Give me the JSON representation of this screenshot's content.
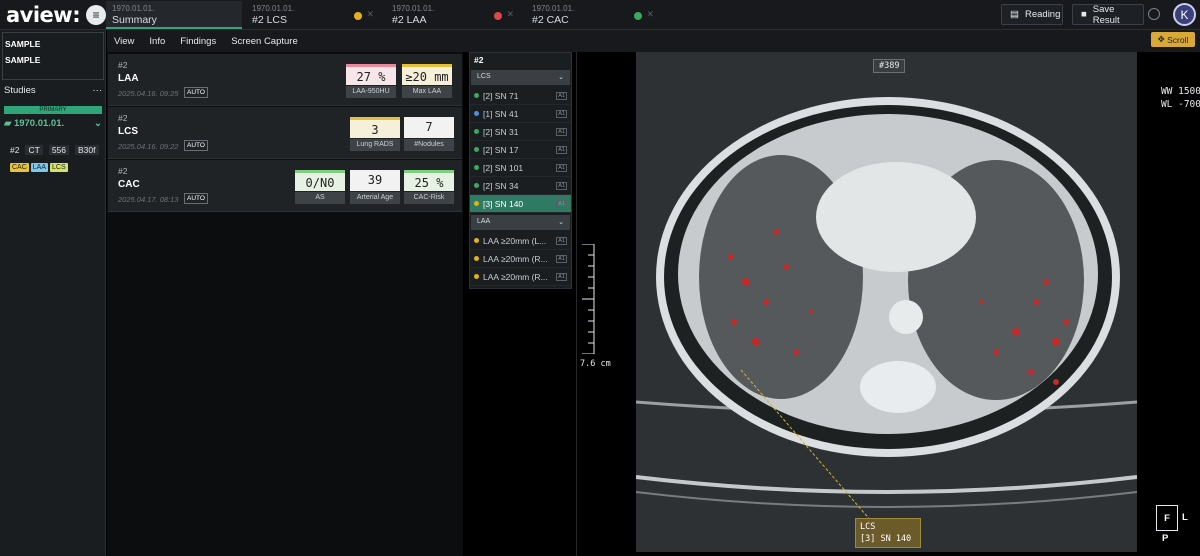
{
  "app": {
    "logo": "aview:",
    "logo_icon": "list-add-icon"
  },
  "tabs": [
    {
      "date": "1970.01.01.",
      "name": "Summary"
    },
    {
      "date": "1970.01.01.",
      "name": "#2  LCS",
      "status_color": "#e6b118"
    },
    {
      "date": "1970.01.01.",
      "name": "#2  LAA",
      "status_color": "#d84a4a"
    },
    {
      "date": "1970.01.01.",
      "name": "#2  CAC",
      "status_color": "#3caa5c"
    }
  ],
  "toolbar": {
    "reading_label": "Reading",
    "save_label": "Save Result",
    "avatar_initial": "K"
  },
  "sidebar": {
    "patient_name": "SAMPLE",
    "patient_id": "SAMPLE",
    "studies_label": "Studies",
    "more": "···",
    "primary_label": "PRIMARY",
    "study_date": "1970.01.01.",
    "series": {
      "number": "#2",
      "modality": "CT",
      "count": "556",
      "kernel": "B30f"
    },
    "badges": [
      {
        "label": "CAC",
        "color": "#e8c33a"
      },
      {
        "label": "LAA",
        "color": "#7cc7ee"
      },
      {
        "label": "LCS",
        "color": "#d6e36a"
      }
    ]
  },
  "menu": {
    "items": [
      "View",
      "Info",
      "Findings",
      "Screen Capture"
    ],
    "scroll_label": "Scroll"
  },
  "summary": {
    "cards": [
      {
        "idx": "#2",
        "title": "LAA",
        "time": "2025.04.16. 09:25",
        "auto": "AUTO",
        "metrics": [
          {
            "value": "27 %",
            "label": "LAA-950HU",
            "accent": "#e88a9a"
          },
          {
            "value": "≥20 mm",
            "label": "Max LAA",
            "accent": "#e6c03a"
          }
        ]
      },
      {
        "idx": "#2",
        "title": "LCS",
        "time": "2025.04.16. 09:22",
        "auto": "AUTO",
        "metrics": [
          {
            "value": "3",
            "label": "Lung RADS",
            "accent": "#e6c03a"
          },
          {
            "value": "7",
            "label": "#Nodules",
            "accent": "#cfd4d9"
          }
        ]
      },
      {
        "idx": "#2",
        "title": "CAC",
        "time": "2025.04.17. 08:13",
        "auto": "AUTO",
        "metrics": [
          {
            "value": "0/N0",
            "label": "AS",
            "accent": "#7fcf7f"
          },
          {
            "value": "39",
            "label": "Arterial Age",
            "accent": "#cfd4d9"
          },
          {
            "value": "25 %",
            "label": "CAC-Risk",
            "accent": "#7fcf7f"
          }
        ]
      }
    ]
  },
  "findings": {
    "header": "#2",
    "groups": [
      {
        "name": "LCS",
        "items": [
          {
            "label": "[2] SN 71",
            "tag": "A1",
            "color": "#3caa5c"
          },
          {
            "label": "[1] SN 41",
            "tag": "A1",
            "color": "#4a8fe0"
          },
          {
            "label": "[2] SN 31",
            "tag": "A1",
            "color": "#3caa5c"
          },
          {
            "label": "[2] SN 17",
            "tag": "A1",
            "color": "#3caa5c"
          },
          {
            "label": "[2] SN 101",
            "tag": "A1",
            "color": "#3caa5c"
          },
          {
            "label": "[2] SN 34",
            "tag": "A1",
            "color": "#3caa5c"
          },
          {
            "label": "[3] SN 140",
            "tag": "A1",
            "color": "#e6b118",
            "selected": true
          }
        ]
      },
      {
        "name": "LAA",
        "items": [
          {
            "label": "LAA ≥20mm (L...",
            "tag": "A1",
            "color": "#e6b118"
          },
          {
            "label": "LAA ≥20mm (R...",
            "tag": "A1",
            "color": "#e6b118"
          },
          {
            "label": "LAA ≥20mm (R...",
            "tag": "A1",
            "color": "#e6b118"
          }
        ]
      }
    ]
  },
  "viewer": {
    "slice": "#389",
    "ww": "WW 1500",
    "wl": "WL -700",
    "ruler": "7.6 cm",
    "orientation": {
      "front": "F",
      "left": "L",
      "posterior": "P"
    },
    "annotation": {
      "title": "LCS",
      "detail": "[3] SN 140"
    }
  }
}
